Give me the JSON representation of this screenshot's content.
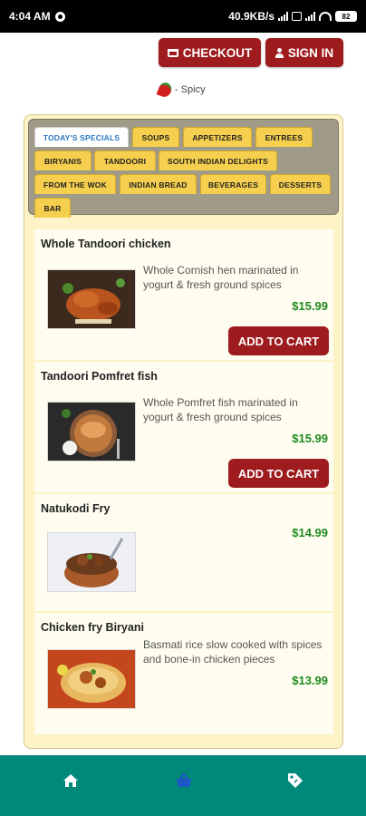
{
  "status_bar": {
    "time": "4:04 AM",
    "network_speed": "40.9KB/s",
    "battery": "82"
  },
  "header": {
    "checkout_label": "CHECKOUT",
    "signin_label": "SIGN IN",
    "spicy_legend": "- Spicy"
  },
  "tabs": [
    {
      "label": "TODAY'S SPECIALS",
      "active": true
    },
    {
      "label": "SOUPS"
    },
    {
      "label": "APPETIZERS"
    },
    {
      "label": "ENTREES"
    },
    {
      "label": "BIRYANIS"
    },
    {
      "label": "TANDOORI"
    },
    {
      "label": "SOUTH INDIAN DELIGHTS"
    },
    {
      "label": "FROM THE WOK"
    },
    {
      "label": "INDIAN BREAD"
    },
    {
      "label": "BEVERAGES"
    },
    {
      "label": "DESSERTS"
    },
    {
      "label": "BAR"
    }
  ],
  "menu_items": [
    {
      "name": "Whole Tandoori chicken",
      "description": "Whole Cornish hen marinated in yogurt & fresh ground spices",
      "price": "$15.99",
      "button": "ADD TO CART"
    },
    {
      "name": "Tandoori Pomfret fish",
      "description": "Whole Pomfret fish marinated in yogurt & fresh ground spices",
      "price": "$15.99",
      "button": "ADD TO CART"
    },
    {
      "name": "Natukodi Fry",
      "description": "",
      "price": "$14.99"
    },
    {
      "name": "Chicken fry Biryani",
      "description": "Basmati rice slow cooked with spices and bone-in chicken pieces",
      "price": "$13.99"
    }
  ],
  "colors": {
    "brand_red": "#9e1b1e",
    "nav_teal": "#00897b",
    "price_green": "#1f8a1f",
    "tab_yellow": "#f6cf4e",
    "active_tab_text": "#2a78c2"
  },
  "bottom_nav": [
    {
      "icon": "home-icon"
    },
    {
      "icon": "basket-icon",
      "active": true
    },
    {
      "icon": "tag-icon"
    }
  ]
}
